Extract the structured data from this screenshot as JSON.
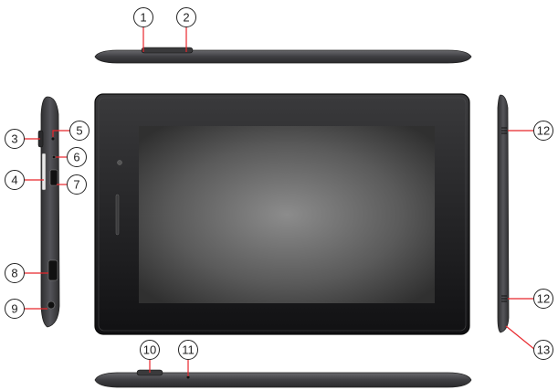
{
  "callouts": [
    {
      "id": "1",
      "label": "1"
    },
    {
      "id": "2",
      "label": "2"
    },
    {
      "id": "3",
      "label": "3"
    },
    {
      "id": "4",
      "label": "4"
    },
    {
      "id": "5",
      "label": "5"
    },
    {
      "id": "6",
      "label": "6"
    },
    {
      "id": "7",
      "label": "7"
    },
    {
      "id": "8",
      "label": "8"
    },
    {
      "id": "9",
      "label": "9"
    },
    {
      "id": "10",
      "label": "10"
    },
    {
      "id": "11",
      "label": "11"
    },
    {
      "id": "12a",
      "label": "12"
    },
    {
      "id": "12b",
      "label": "12"
    },
    {
      "id": "13",
      "label": "13"
    }
  ],
  "colors": {
    "callout_line": "#e8262b",
    "device_body": "#4a4a4e",
    "bezel": "#1a1a1a",
    "screen_center": "#8a8a8a",
    "screen_edge": "#3a3a3a"
  }
}
